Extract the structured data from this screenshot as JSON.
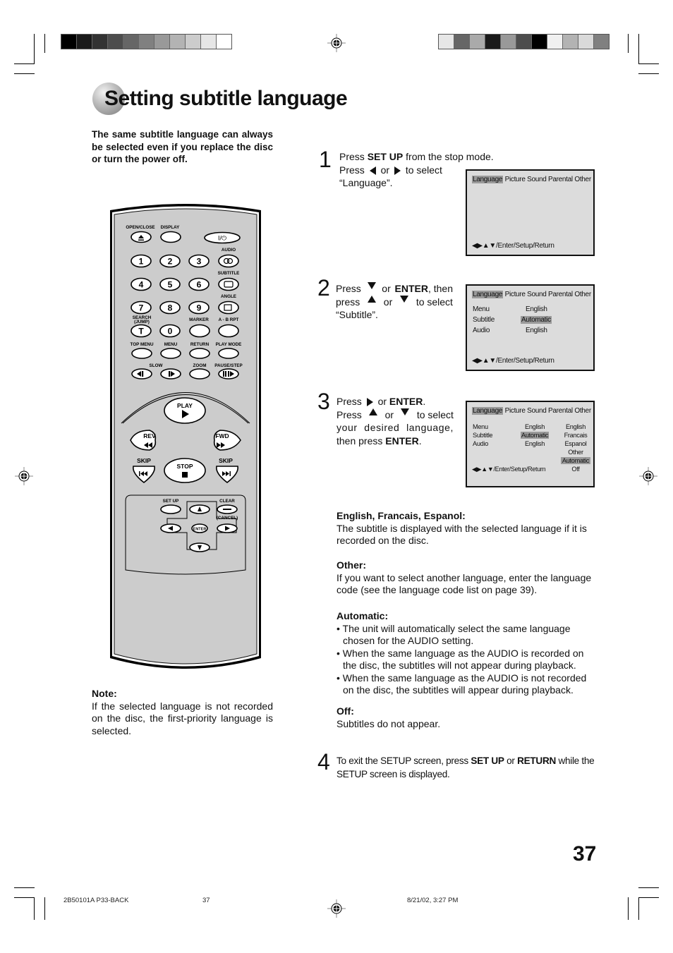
{
  "printer_marks": {
    "left_color_bars": [
      "#000000",
      "#1a1a1a",
      "#333333",
      "#4d4d4d",
      "#666666",
      "#808080",
      "#999999",
      "#b3b3b3",
      "#cccccc",
      "#e6e6e6",
      "#ffffff"
    ],
    "right_color_bars": [
      "#e6e6e6",
      "#666666",
      "#aaaaaa",
      "#1a1a1a",
      "#999999",
      "#4d4d4d",
      "#000000",
      "#f0f0f0",
      "#b3b3b3",
      "#d9d9d9",
      "#808080"
    ]
  },
  "header": {
    "title": "Setting subtitle language"
  },
  "intro": "The same subtitle language can always be selected even if you replace the disc or turn the power off.",
  "remote": {
    "labels": {
      "open_close": "OPEN/CLOSE",
      "display": "DISPLAY",
      "power": "I/⏻",
      "audio": "AUDIO",
      "subtitle": "SUBTITLE",
      "angle": "ANGLE",
      "search": "SEARCH",
      "jump": "(JUMP)",
      "marker": "MARKER",
      "ab_rpt": "A - B RPT",
      "top_menu": "TOP MENU",
      "menu": "MENU",
      "return": "RETURN",
      "play_mode": "PLAY MODE",
      "slow": "SLOW",
      "zoom": "ZOOM",
      "pause_step": "PAUSE/STEP",
      "play": "PLAY",
      "rev": "REV",
      "fwd": "FWD",
      "skip_left": "SKIP",
      "skip_right": "SKIP",
      "stop": "STOP",
      "set_up": "SET UP",
      "clear": "CLEAR",
      "cancel": "(CANCEL)",
      "enter": "ENTER"
    },
    "digits": [
      "1",
      "2",
      "3",
      "4",
      "5",
      "6",
      "7",
      "8",
      "9",
      "T",
      "0"
    ],
    "body_color": "#cccccc"
  },
  "steps": [
    {
      "number": "1",
      "lines": [
        "Press ",
        "SET UP",
        " from the stop mode.",
        "Press",
        "or",
        "to select",
        "“Language”."
      ],
      "osd": {
        "menubar": [
          "Language",
          "Picture",
          "Sound",
          "Parental",
          "Other"
        ],
        "selected": "Language",
        "footer": "/Enter/Setup/Return"
      }
    },
    {
      "number": "2",
      "lines": [
        "Press",
        "or",
        "ENTER",
        ", then",
        "press",
        "or",
        "to select",
        "“Subtitle”."
      ],
      "osd": {
        "menubar": [
          "Language",
          "Picture",
          "Sound",
          "Parental",
          "Other"
        ],
        "selected": "Language",
        "rows": [
          {
            "label": "Menu",
            "value": "English"
          },
          {
            "label": "Subtitle",
            "value": "Automatic"
          },
          {
            "label": "Audio",
            "value": "English"
          }
        ],
        "highlighted_value": "Automatic",
        "footer": "/Enter/Setup/Return"
      }
    },
    {
      "number": "3",
      "lines": [
        "Press",
        "or",
        "ENTER",
        ".",
        "Press",
        "or",
        "to select",
        "your desired language,",
        "then press ",
        "ENTER",
        "."
      ],
      "osd": {
        "menubar": [
          "Language",
          "Picture",
          "Sound",
          "Parental",
          "Other"
        ],
        "selected": "Language",
        "rows": [
          {
            "label": "Menu",
            "value": "English"
          },
          {
            "label": "Subtitle",
            "value": "Automatic"
          },
          {
            "label": "Audio",
            "value": "English"
          }
        ],
        "options": [
          "English",
          "Francais",
          "Espanol",
          "Other",
          "Automatic",
          "Off"
        ],
        "highlighted_option": "Automatic",
        "footer": "/Enter/Setup/Return"
      }
    },
    {
      "number": "4",
      "lines": [
        "To exit the SETUP screen, press ",
        "SET UP",
        " or ",
        "RETURN",
        " while the SETUP screen is displayed."
      ]
    }
  ],
  "explanations": [
    {
      "heading": "English, Francais, Espanol:",
      "text": "The subtitle is displayed with the selected language if it is recorded on the disc."
    },
    {
      "heading": "Other:",
      "text": "If you want to select another language, enter the language code (see the language code list on page 39)."
    },
    {
      "heading": "Automatic:",
      "bullets": [
        "The unit will automatically select the same language chosen for the AUDIO setting.",
        "When the same language as the AUDIO is recorded on the disc, the subtitles will not appear during playback.",
        "When the same language as the AUDIO is not recorded on the disc, the subtitles will appear during playback."
      ]
    },
    {
      "heading": "Off:",
      "text": "Subtitles do not appear."
    }
  ],
  "note": {
    "heading": "Note:",
    "text": "If the selected language is not recorded on the disc, the first-priority language is selected."
  },
  "page_number": "37",
  "footer": {
    "job": "2B50101A P33-BACK",
    "page": "37",
    "timestamp": "8/21/02, 3:27 PM"
  }
}
